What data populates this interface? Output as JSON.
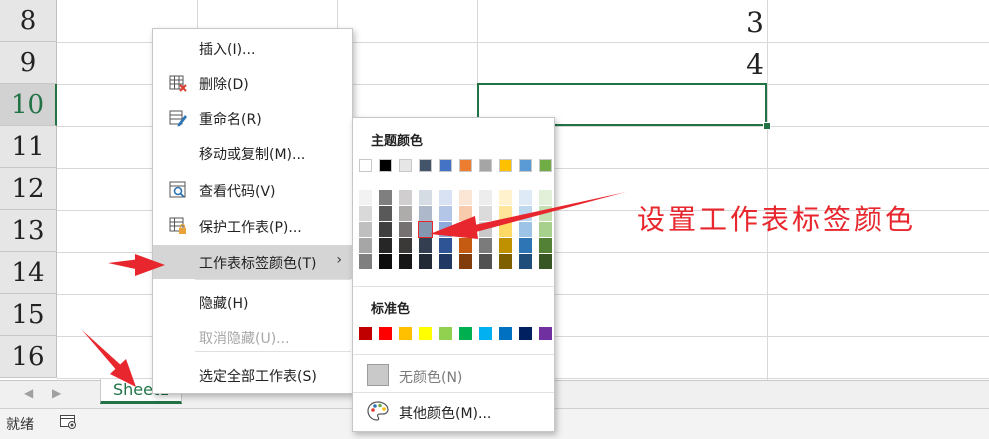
{
  "grid": {
    "rows": [
      {
        "num": "8",
        "selected": false
      },
      {
        "num": "9",
        "selected": false
      },
      {
        "num": "10",
        "selected": true
      },
      {
        "num": "11",
        "selected": false
      },
      {
        "num": "12",
        "selected": false
      },
      {
        "num": "13",
        "selected": false
      },
      {
        "num": "14",
        "selected": false
      },
      {
        "num": "15",
        "selected": false
      },
      {
        "num": "16",
        "selected": false
      }
    ],
    "values": [
      "3",
      "4"
    ]
  },
  "context_menu": {
    "items": [
      {
        "label": "插入(I)...",
        "icon": "",
        "disabled": false
      },
      {
        "label": "删除(D)",
        "icon": "delete-sheet-icon",
        "disabled": false
      },
      {
        "label": "重命名(R)",
        "icon": "rename-icon",
        "disabled": false
      },
      {
        "label": "移动或复制(M)...",
        "icon": "",
        "disabled": false
      },
      {
        "label": "查看代码(V)",
        "icon": "view-code-icon",
        "disabled": false
      },
      {
        "label": "保护工作表(P)...",
        "icon": "protect-sheet-icon",
        "disabled": false
      },
      {
        "label": "工作表标签颜色(T)",
        "icon": "",
        "disabled": false,
        "highlighted": true,
        "submenu": true
      },
      {
        "label": "隐藏(H)",
        "icon": "",
        "disabled": false
      },
      {
        "label": "取消隐藏(U)...",
        "icon": "",
        "disabled": true
      },
      {
        "label": "选定全部工作表(S)",
        "icon": "",
        "disabled": false
      }
    ]
  },
  "color_picker": {
    "theme_title": "主题颜色",
    "standard_title": "标准色",
    "no_color": "无颜色(N)",
    "more_colors": "其他颜色(M)...",
    "theme_colors": [
      [
        "#ffffff",
        "#f2f2f2",
        "#d9d9d9",
        "#bfbfbf",
        "#a6a6a6",
        "#7f7f7f"
      ],
      [
        "#000000",
        "#7f7f7f",
        "#595959",
        "#3f3f3f",
        "#262626",
        "#0d0d0d"
      ],
      [
        "#e7e6e6",
        "#d0cece",
        "#aeabab",
        "#767171",
        "#3b3838",
        "#171616"
      ],
      [
        "#44546a",
        "#d6dce4",
        "#adb9ca",
        "#8497b0",
        "#333f50",
        "#222a35"
      ],
      [
        "#4472c4",
        "#d9e2f3",
        "#b4c6e7",
        "#8eaadb",
        "#2f5496",
        "#1f3864"
      ],
      [
        "#ed7d31",
        "#fbe5d5",
        "#f7cbac",
        "#f4b183",
        "#c55a11",
        "#833c0b"
      ],
      [
        "#a5a5a5",
        "#ededed",
        "#dbdbdb",
        "#c9c9c9",
        "#7b7b7b",
        "#525252"
      ],
      [
        "#ffc000",
        "#fff2cc",
        "#fee599",
        "#ffd966",
        "#bf9000",
        "#7f6000"
      ],
      [
        "#5b9bd5",
        "#deebf6",
        "#bdd7ee",
        "#9dc3e6",
        "#2e75b5",
        "#1e4e79"
      ],
      [
        "#70ad47",
        "#e2efd9",
        "#c5e0b3",
        "#a8d08d",
        "#538135",
        "#375623"
      ]
    ],
    "standard_colors": [
      "#c00000",
      "#ff0000",
      "#ffc000",
      "#ffff00",
      "#92d050",
      "#00b050",
      "#00b0f0",
      "#0070c0",
      "#002060",
      "#7030a0"
    ]
  },
  "tabs": {
    "sheet_name": "Sheet1",
    "nav_prev": "◀",
    "nav_next": "▶"
  },
  "status": {
    "ready": "就绪"
  },
  "annotation": {
    "text": "设置工作表标签颜色",
    "color": "#e8262d"
  },
  "accent": "#217346"
}
